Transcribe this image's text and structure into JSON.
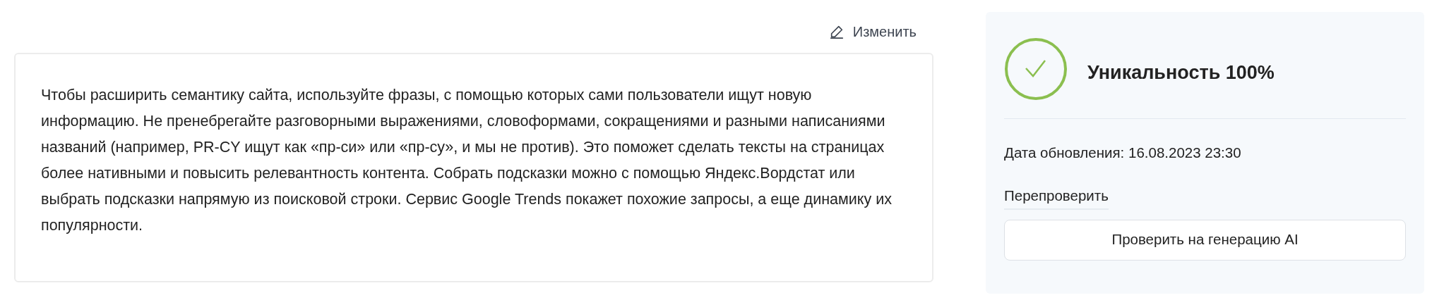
{
  "edit_link": {
    "label": "Изменить"
  },
  "text_card": {
    "text": "Чтобы расширить семантику сайта, используйте фразы, с помощью которых сами пользователи ищут новую информацию. Не пренебрегайте разговорными выражениями, словоформами, сокращениями и разными написаниями названий (например, PR-CY ищут как «пр-си» или «пр-су», и мы не против). Это поможет сделать тексты на страницах более нативными и повысить релевантность контента. Собрать подсказки можно с помощью Яндекс.Вордстат или выбрать подсказки напрямую из поисковой строки. Сервис Google Trends покажет похожие запросы, а еще динамику их популярности."
  },
  "result_panel": {
    "passed": true,
    "title": "Уникальность 100%",
    "updated": "Дата обновления: 16.08.2023 23:30",
    "recheck_link": "Перепроверить",
    "ai_button": "Проверить на генерацию AI"
  }
}
